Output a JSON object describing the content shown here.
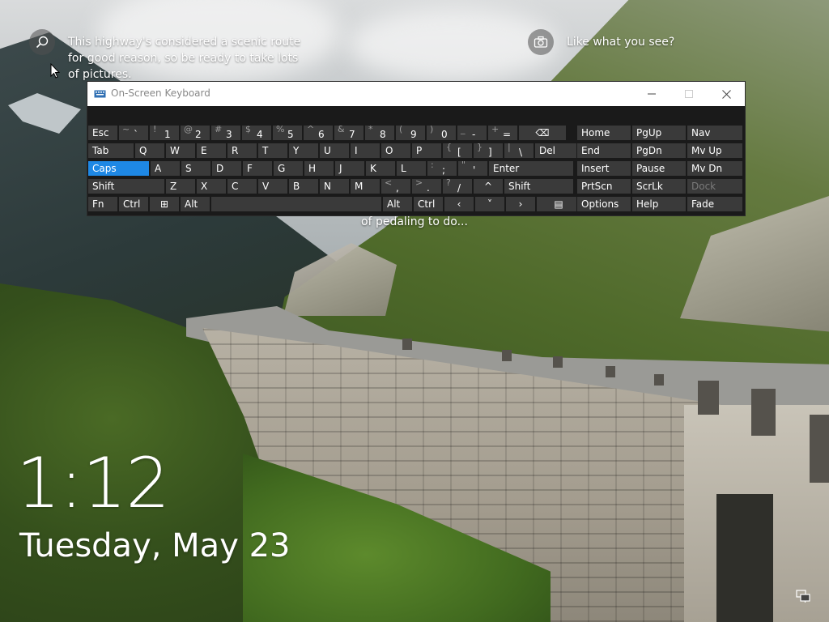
{
  "lockscreen": {
    "spotlight_text": [
      "This highway's considered a scenic route",
      "for good reason, so be ready to take lots",
      "of pictures."
    ],
    "like_text": "Like what you see?",
    "behind_text": "of pedaling to do...",
    "time": "1:12",
    "date": "Tuesday, May 23",
    "icons": [
      "search-icon",
      "camera-icon",
      "network-icon"
    ]
  },
  "osk": {
    "title": "On-Screen Keyboard",
    "window_controls": [
      "minimize-icon",
      "maximize-icon",
      "close-icon"
    ],
    "row1": [
      {
        "l": "Esc"
      },
      {
        "s": "~",
        "m": "`"
      },
      {
        "s": "!",
        "m": "1"
      },
      {
        "s": "@",
        "m": "2"
      },
      {
        "s": "#",
        "m": "3"
      },
      {
        "s": "$",
        "m": "4"
      },
      {
        "s": "%",
        "m": "5"
      },
      {
        "s": "^",
        "m": "6"
      },
      {
        "s": "&",
        "m": "7"
      },
      {
        "s": "*",
        "m": "8"
      },
      {
        "s": "(",
        "m": "9"
      },
      {
        "s": ")",
        "m": "0"
      },
      {
        "s": "_",
        "m": "-"
      },
      {
        "s": "+",
        "m": "="
      },
      {
        "l": "⌫"
      }
    ],
    "row2": [
      {
        "l": "Tab"
      },
      {
        "l": "Q"
      },
      {
        "l": "W"
      },
      {
        "l": "E"
      },
      {
        "l": "R"
      },
      {
        "l": "T"
      },
      {
        "l": "Y"
      },
      {
        "l": "U"
      },
      {
        "l": "I"
      },
      {
        "l": "O"
      },
      {
        "l": "P"
      },
      {
        "s": "{",
        "m": "["
      },
      {
        "s": "}",
        "m": "]"
      },
      {
        "s": "|",
        "m": "\\"
      },
      {
        "l": "Del"
      }
    ],
    "row3": [
      {
        "l": "Caps"
      },
      {
        "l": "A"
      },
      {
        "l": "S"
      },
      {
        "l": "D"
      },
      {
        "l": "F"
      },
      {
        "l": "G"
      },
      {
        "l": "H"
      },
      {
        "l": "J"
      },
      {
        "l": "K"
      },
      {
        "l": "L"
      },
      {
        "s": ":",
        "m": ";"
      },
      {
        "s": "\"",
        "m": "'"
      },
      {
        "l": "Enter"
      }
    ],
    "row4": [
      {
        "l": "Shift"
      },
      {
        "l": "Z"
      },
      {
        "l": "X"
      },
      {
        "l": "C"
      },
      {
        "l": "V"
      },
      {
        "l": "B"
      },
      {
        "l": "N"
      },
      {
        "l": "M"
      },
      {
        "s": "<",
        "m": ","
      },
      {
        "s": ">",
        "m": "."
      },
      {
        "s": "?",
        "m": "/"
      },
      {
        "l": "^"
      },
      {
        "l": "Shift"
      }
    ],
    "row5": [
      {
        "l": "Fn"
      },
      {
        "l": "Ctrl"
      },
      {
        "l": "⊞"
      },
      {
        "l": "Alt"
      },
      {
        "l": ""
      },
      {
        "l": "Alt"
      },
      {
        "l": "Ctrl"
      },
      {
        "l": "‹"
      },
      {
        "l": "˅"
      },
      {
        "l": "›"
      },
      {
        "l": "▤"
      }
    ],
    "nav": [
      [
        "Home",
        "PgUp",
        "Nav"
      ],
      [
        "End",
        "PgDn",
        "Mv Up"
      ],
      [
        "Insert",
        "Pause",
        "Mv Dn"
      ],
      [
        "PrtScn",
        "ScrLk",
        "Dock"
      ],
      [
        "Options",
        "Help",
        "Fade"
      ]
    ],
    "active_key": "Caps",
    "disabled_key": "Dock",
    "colors": {
      "active": "#1e88e5",
      "key": "#3a3a3a",
      "window": "#1a1a1a"
    }
  }
}
